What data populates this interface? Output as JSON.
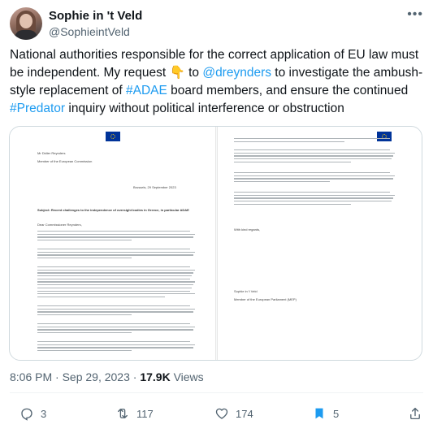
{
  "author": {
    "name": "Sophie in 't Veld",
    "handle": "@SophieintVeld"
  },
  "tweet": {
    "parts": [
      {
        "t": "National authorities responsible for the correct application of EU law must be independent. My request ",
        "link": false
      },
      {
        "t": "👇",
        "link": false
      },
      {
        "t": " to ",
        "link": false
      },
      {
        "t": "@dreynders",
        "link": true
      },
      {
        "t": " to investigate the ambush-style replacement of ",
        "link": false
      },
      {
        "t": "#ADAE",
        "link": true
      },
      {
        "t": " board members, and ensure the continued ",
        "link": false
      },
      {
        "t": "#Predator",
        "link": true
      },
      {
        "t": " inquiry without political interference or obstruction",
        "link": false
      }
    ]
  },
  "letter": {
    "recipient_name": "Mr Didier Reynders",
    "recipient_role": "Member of the European Commission",
    "place_date": "Brussels, 29 September 2023",
    "subject": "Subject: Recent challenges to the independence of oversight bodies in Greece, in particular ADAE",
    "salutation": "Dear Commissioner Reynders,",
    "closing": "With kind regards,",
    "signer_name": "Sophie in 't Veld",
    "signer_role": "Member of the European Parliament (MEP)"
  },
  "meta": {
    "time": "8:06 PM · Sep 29, 2023 · ",
    "views_count": "17.9K",
    "views_label": " Views"
  },
  "actions": {
    "replies": "3",
    "retweets": "117",
    "likes": "174",
    "bookmarks": "5"
  },
  "colors": {
    "accent": "#1d9bf0",
    "muted": "#536471"
  }
}
